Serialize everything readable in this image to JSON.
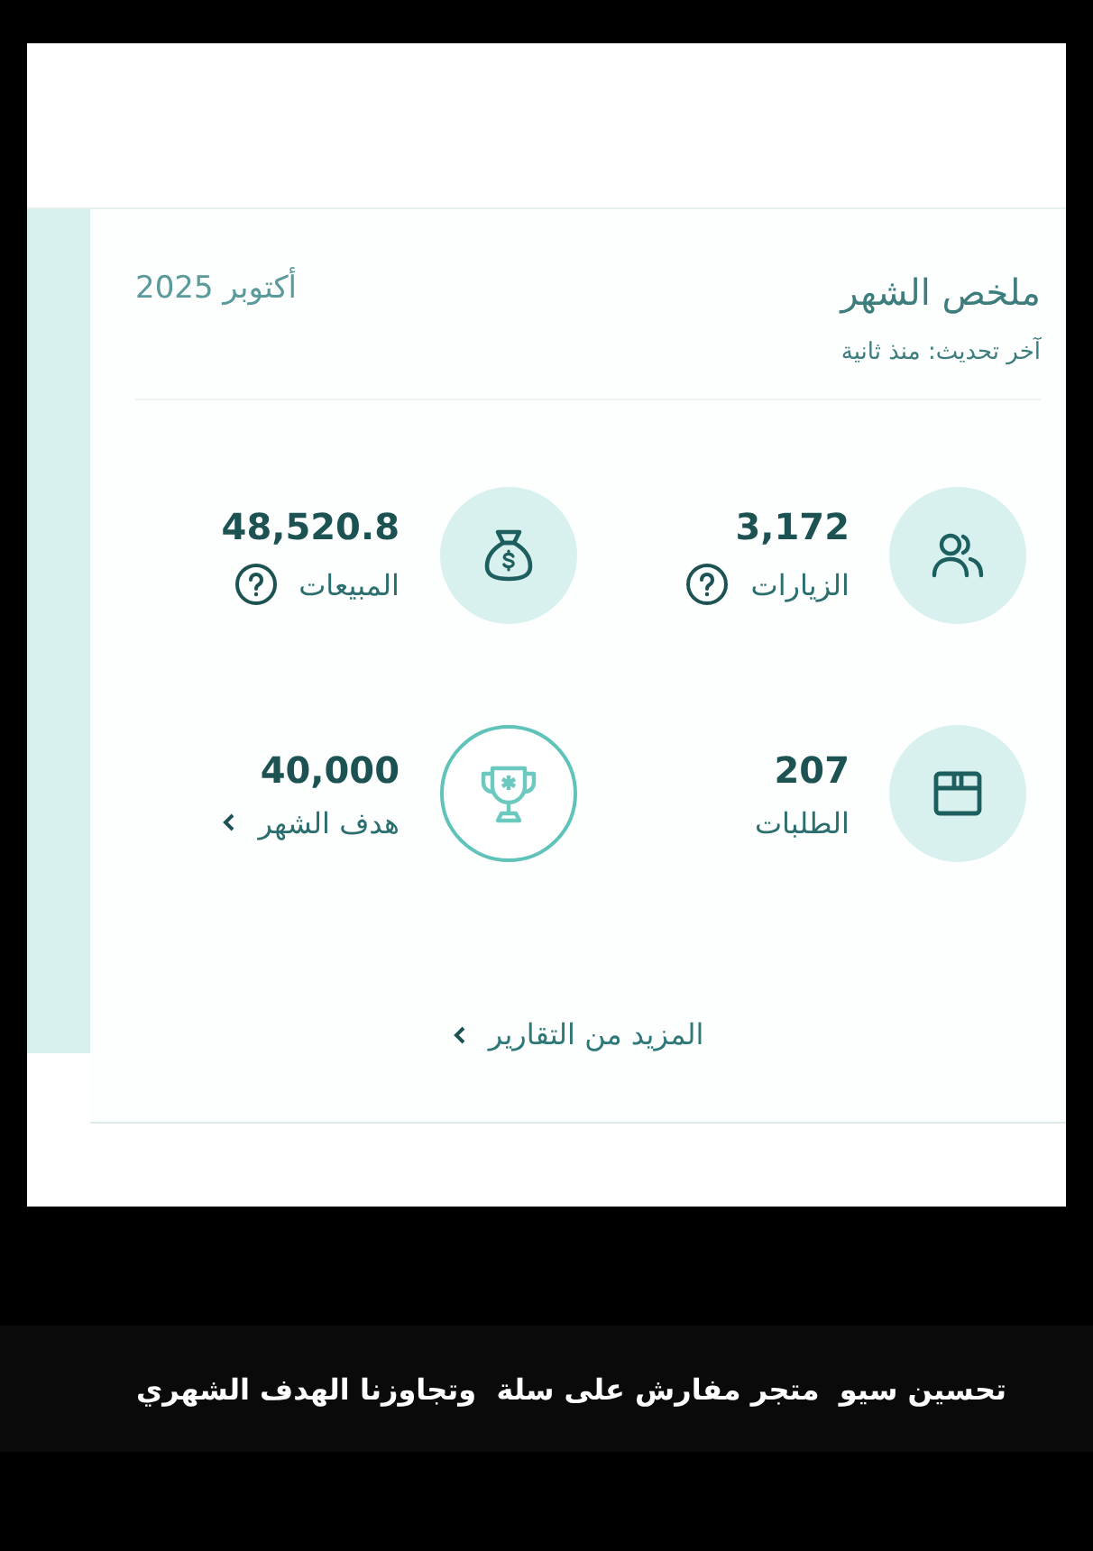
{
  "summary": {
    "title": "ملخص الشهر",
    "updated": "آخر تحديث: منذ ثانية",
    "month": "أكتوبر 2025"
  },
  "stats": [
    {
      "kind": "visits",
      "value": "3,172",
      "label": "الزيارات",
      "help": true,
      "link": false
    },
    {
      "kind": "sales",
      "value": "48,520.8",
      "label": "المبيعات",
      "help": true,
      "link": false
    },
    {
      "kind": "orders",
      "value": "207",
      "label": "الطلبات",
      "help": false,
      "link": false
    },
    {
      "kind": "goal",
      "value": "40,000",
      "label": "هدف الشهر",
      "help": false,
      "link": true
    }
  ],
  "more_link": {
    "label": "المزيد من التقارير"
  },
  "caption": "تحسين سيو  متجر مفارش على سلة  وتجاوزنا الهدف الشهري"
}
